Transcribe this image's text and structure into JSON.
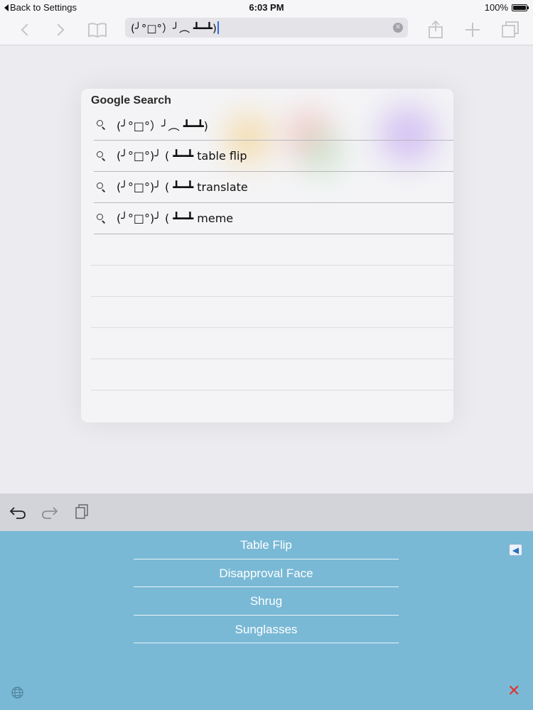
{
  "status_bar": {
    "back_label": "Back to Settings",
    "time": "6:03 PM",
    "battery_text": "100%",
    "battery_level": 1.0
  },
  "toolbar": {
    "back_icon": "chevron-left-icon",
    "forward_icon": "chevron-right-icon",
    "bookmarks_icon": "book-icon",
    "address_value": "(╯°□°）╯︵ ┻━┻)",
    "share_icon": "share-icon",
    "new_tab_icon": "plus-icon",
    "tabs_icon": "tabs-icon",
    "clear_icon": "clear-icon"
  },
  "suggestions": {
    "title": "Google Search",
    "items": [
      {
        "text": "(╯°□°）╯︵ ┻━┻)"
      },
      {
        "text": "(╯°□°)╯ ( ┻━┻ table flip"
      },
      {
        "text": "(╯°□°)╯ ( ┻━┻ translate"
      },
      {
        "text": "(╯°□°)╯ ( ┻━┻ meme"
      }
    ],
    "empty_rows": 6
  },
  "keyboard_toolbar": {
    "undo_icon": "undo-icon",
    "redo_icon": "redo-icon",
    "paste_icon": "clipboard-icon"
  },
  "keyboard": {
    "items": [
      "Table Flip",
      "Disapproval Face",
      "Shrug",
      "Sunglasses"
    ],
    "return_icon": "return-icon",
    "globe_icon": "globe-icon",
    "close_icon": "close-icon",
    "close_color": "#e0342b",
    "background_color": "#79b9d6"
  }
}
